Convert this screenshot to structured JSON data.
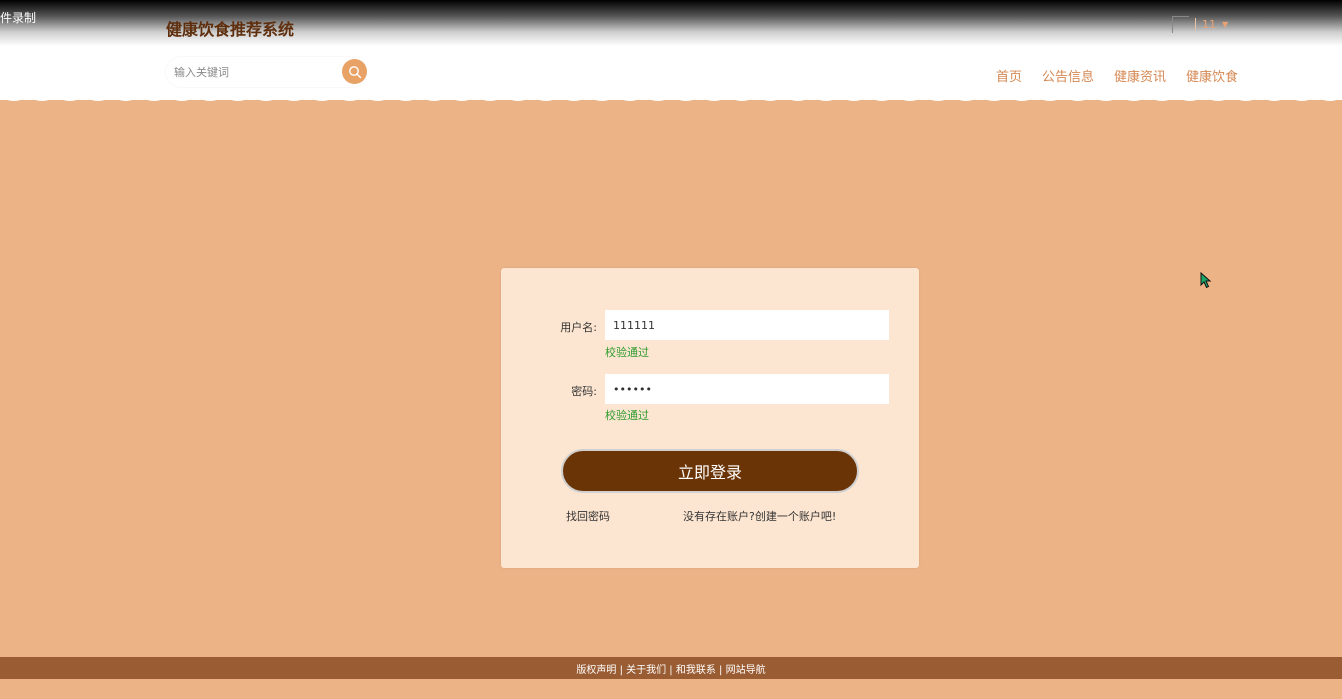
{
  "recorder": {
    "label": "件录制"
  },
  "header": {
    "title": "健康饮食推荐系统",
    "user_name": "11",
    "search": {
      "placeholder": "输入关键词",
      "value": ""
    },
    "nav": [
      {
        "label": "首页"
      },
      {
        "label": "公告信息"
      },
      {
        "label": "健康资讯"
      },
      {
        "label": "健康饮食"
      }
    ]
  },
  "login": {
    "username_label": "用户名:",
    "username_value": "111111",
    "username_status": "校验通过",
    "password_label": "密码:",
    "password_value": "••••••",
    "password_status": "校验通过",
    "submit_label": "立即登录",
    "forgot_label": "找回密码",
    "register_label": "没有存在账户?创建一个账户吧!"
  },
  "footer": {
    "links": "版权声明 | 关于我们 | 和我联系 | 网站导航"
  },
  "colors": {
    "page_bg": "#ecb387",
    "card_bg": "#fde6d1",
    "button_bg": "#6b3406",
    "footer_bg": "#9a5c33",
    "nav_text": "#d58852",
    "valid_text": "#2e9b2e"
  },
  "icons": {
    "search": "search-icon",
    "cursor": "mouse-cursor-icon"
  }
}
